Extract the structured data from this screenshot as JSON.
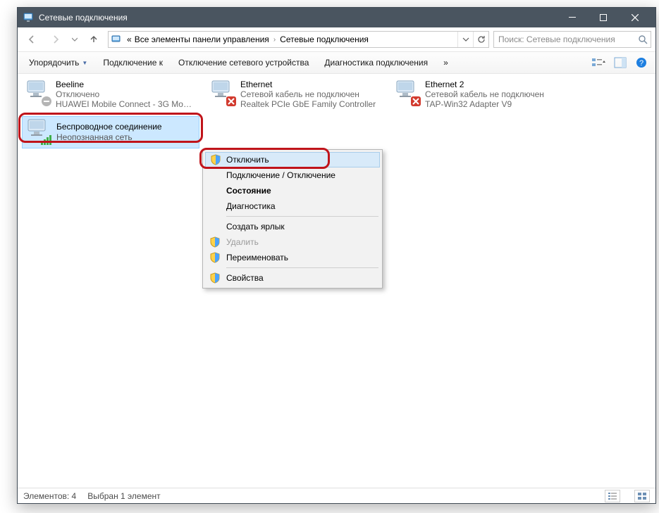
{
  "window": {
    "title": "Сетевые подключения"
  },
  "breadcrumb": {
    "prefix": "«",
    "item1": "Все элементы панели управления",
    "item2": "Сетевые подключения"
  },
  "search": {
    "placeholder": "Поиск: Сетевые подключения"
  },
  "commandbar": {
    "organize": "Упорядочить",
    "connect": "Подключение к",
    "disable": "Отключение сетевого устройства",
    "diagnose": "Диагностика подключения",
    "more": "»"
  },
  "connections": [
    {
      "name": "Beeline",
      "status": "Отключено",
      "device": "HUAWEI Mobile Connect - 3G Mo…",
      "badge": "disabled"
    },
    {
      "name": "Ethernet",
      "status": "Сетевой кабель не подключен",
      "device": "Realtek PCIe GbE Family Controller",
      "badge": "x"
    },
    {
      "name": "Ethernet 2",
      "status": "Сетевой кабель не подключен",
      "device": "TAP-Win32 Adapter V9",
      "badge": "x"
    },
    {
      "name": "Беспроводное соединение",
      "status": "Неопознанная сеть",
      "device": "",
      "badge": "wifi",
      "selected": true
    }
  ],
  "context_menu": {
    "items": [
      {
        "label": "Отключить",
        "shield": true,
        "hover": true
      },
      {
        "label": "Подключение / Отключение"
      },
      {
        "label": "Состояние",
        "bold": true
      },
      {
        "label": "Диагностика"
      },
      {
        "sep": true
      },
      {
        "label": "Создать ярлык"
      },
      {
        "label": "Удалить",
        "shield": true,
        "disabled": true
      },
      {
        "label": "Переименовать",
        "shield": true
      },
      {
        "sep": true
      },
      {
        "label": "Свойства",
        "shield": true
      }
    ]
  },
  "statusbar": {
    "elements": "Элементов: 4",
    "selected": "Выбран 1 элемент"
  },
  "colors": {
    "titlebar": "#4a5560",
    "highlight_ring": "#c0141b",
    "selection": "#cce8ff"
  }
}
